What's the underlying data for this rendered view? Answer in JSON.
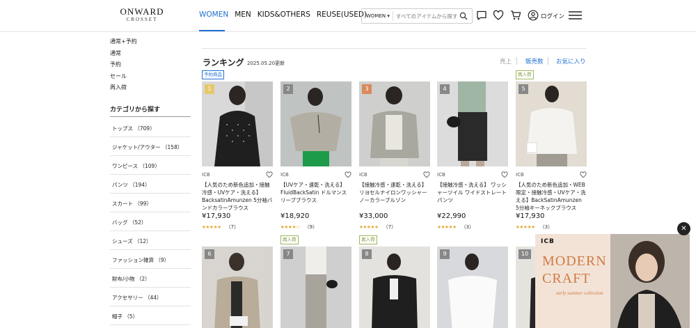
{
  "header": {
    "logo_main": "ONWARD",
    "logo_sub": "CROSSET",
    "nav": [
      "WOMEN",
      "MEN",
      "KIDS&OTHERS",
      "REUSE(USED)"
    ],
    "search": {
      "selected": "WOMEN",
      "placeholder": "すべてのアイテムから探す"
    },
    "login_label": "ログイン"
  },
  "sidebar": {
    "links": [
      "通常+予約",
      "通常",
      "予約",
      "セール",
      "再入荷"
    ],
    "category_title": "カテゴリから探す",
    "categories": [
      "トップス （709）",
      "ジャケット/アウター （158）",
      "ワンピース （109）",
      "パンツ （194）",
      "スカート （99）",
      "バッグ （52）",
      "シューズ （12）",
      "ファッション雑貨 （9）",
      "財布/小物 （2）",
      "アクセサリー （44）",
      "帽子 （5）"
    ]
  },
  "main": {
    "title": "ランキング",
    "date": "2025.05.20更新",
    "sort": [
      "売上",
      "販売数",
      "お気に入り"
    ],
    "sort_active": "売上",
    "products": [
      {
        "rank": "1",
        "tag": "予約商品",
        "brand": "ICB",
        "name": "【人気のため新色追加・接触冷感・UVケア・洗える】BacksatinAmunzen 5分袖バンドカラーブラウス",
        "price": "¥17,930",
        "rating": 4.5,
        "stars": "★★★★★",
        "count": "（7）"
      },
      {
        "rank": "2",
        "tag": "",
        "brand": "ICB",
        "name": "【UVケア・速乾・洗える】FluidBackSatin ドルマンスリーブブラウス",
        "price": "¥18,920",
        "rating": 4.0,
        "stars": "★★★★☆",
        "count": "（9）"
      },
      {
        "rank": "3",
        "tag": "",
        "brand": "ICB",
        "name": "【接触冷感・速乾・洗える】リヨセルナイロンワッシャー ノーカラーブルゾン",
        "price": "¥33,000",
        "rating": 4.5,
        "stars": "★★★★★",
        "count": "（7）"
      },
      {
        "rank": "4",
        "tag": "",
        "brand": "ICB",
        "name": "【接触冷感・洗える】 ワッシャーツイル ワイドストレートパンツ",
        "price": "¥22,990",
        "rating": 4.5,
        "stars": "★★★★★",
        "count": "（3）"
      },
      {
        "rank": "5",
        "tag": "再入荷",
        "brand": "ICB",
        "name": "【人気のため新色追加・WEB限定・接触冷感・UVケア・洗える】BackSatinAmunzen 5分袖キーネックブラウス",
        "price": "¥17,930",
        "rating": 5.0,
        "stars": "★★★★★",
        "count": "（3）"
      },
      {
        "rank": "6",
        "tag": ""
      },
      {
        "rank": "7",
        "tag": "再入荷"
      },
      {
        "rank": "8",
        "tag": "再入荷"
      },
      {
        "rank": "9",
        "tag": ""
      },
      {
        "rank": "10",
        "tag": ""
      }
    ]
  },
  "banner": {
    "brand": "ICB",
    "title_line1": "MODERN",
    "title_line2": "CRAFT",
    "subtitle": "early summer collection"
  },
  "colors": {
    "accent": "#1e6fd0",
    "star": "#e0a52a",
    "banner_text": "#d07a45"
  }
}
